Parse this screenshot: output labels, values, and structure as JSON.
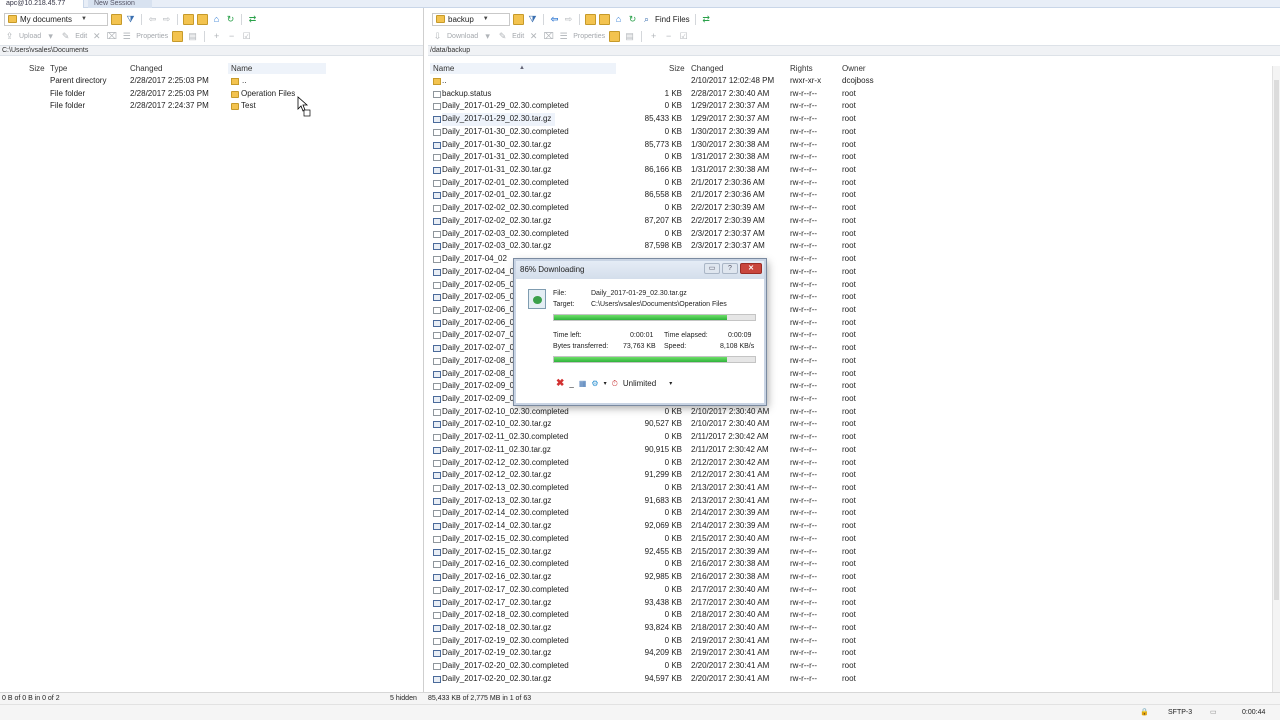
{
  "tabs": {
    "active": "apc@10.218.45.77",
    "new_session": "New Session"
  },
  "left": {
    "drive": "My documents",
    "toolbar2": [
      "Upload",
      "Edit",
      "Properties"
    ],
    "path": "C:\\Users\\vsales\\Documents",
    "columns": {
      "name": "Name",
      "size": "Size",
      "type": "Type",
      "changed": "Changed"
    },
    "rows": [
      {
        "name": "..",
        "type": "Parent directory",
        "changed": "2/28/2017  2:25:03 PM",
        "icon": "up"
      },
      {
        "name": "Operation Files",
        "type": "File folder",
        "changed": "2/28/2017  2:25:03 PM",
        "icon": "folder"
      },
      {
        "name": "Test",
        "type": "File folder",
        "changed": "2/28/2017  2:24:37 PM",
        "icon": "folder"
      }
    ],
    "status": "0 B of 0 B in 0 of 2"
  },
  "right": {
    "folder": "backup",
    "find_files": "Find Files",
    "toolbar2": [
      "Download",
      "Edit",
      "Properties"
    ],
    "path": "/data/backup",
    "columns": {
      "name": "Name",
      "size": "Size",
      "changed": "Changed",
      "rights": "Rights",
      "owner": "Owner"
    },
    "rows": [
      {
        "name": "..",
        "size": "",
        "changed": "2/10/2017 12:02:48 PM",
        "rights": "rwxr-xr-x",
        "owner": "dcojboss",
        "icon": "up"
      },
      {
        "name": "backup.status",
        "size": "1 KB",
        "changed": "2/28/2017 2:30:40 AM",
        "rights": "rw-r--r--",
        "owner": "root",
        "icon": "doc"
      },
      {
        "name": "Daily_2017-01-29_02.30.completed",
        "size": "0 KB",
        "changed": "1/29/2017 2:30:37 AM",
        "rights": "rw-r--r--",
        "owner": "root",
        "icon": "doc"
      },
      {
        "name": "Daily_2017-01-29_02.30.tar.gz",
        "size": "85,433 KB",
        "changed": "1/29/2017 2:30:37 AM",
        "rights": "rw-r--r--",
        "owner": "root",
        "icon": "gz",
        "hl": true
      },
      {
        "name": "Daily_2017-01-30_02.30.completed",
        "size": "0 KB",
        "changed": "1/30/2017 2:30:39 AM",
        "rights": "rw-r--r--",
        "owner": "root",
        "icon": "doc"
      },
      {
        "name": "Daily_2017-01-30_02.30.tar.gz",
        "size": "85,773 KB",
        "changed": "1/30/2017 2:30:38 AM",
        "rights": "rw-r--r--",
        "owner": "root",
        "icon": "gz"
      },
      {
        "name": "Daily_2017-01-31_02.30.completed",
        "size": "0 KB",
        "changed": "1/31/2017 2:30:38 AM",
        "rights": "rw-r--r--",
        "owner": "root",
        "icon": "doc"
      },
      {
        "name": "Daily_2017-01-31_02.30.tar.gz",
        "size": "86,166 KB",
        "changed": "1/31/2017 2:30:38 AM",
        "rights": "rw-r--r--",
        "owner": "root",
        "icon": "gz"
      },
      {
        "name": "Daily_2017-02-01_02.30.completed",
        "size": "0 KB",
        "changed": "2/1/2017 2:30:36 AM",
        "rights": "rw-r--r--",
        "owner": "root",
        "icon": "doc"
      },
      {
        "name": "Daily_2017-02-01_02.30.tar.gz",
        "size": "86,558 KB",
        "changed": "2/1/2017 2:30:36 AM",
        "rights": "rw-r--r--",
        "owner": "root",
        "icon": "gz"
      },
      {
        "name": "Daily_2017-02-02_02.30.completed",
        "size": "0 KB",
        "changed": "2/2/2017 2:30:39 AM",
        "rights": "rw-r--r--",
        "owner": "root",
        "icon": "doc"
      },
      {
        "name": "Daily_2017-02-02_02.30.tar.gz",
        "size": "87,207 KB",
        "changed": "2/2/2017 2:30:39 AM",
        "rights": "rw-r--r--",
        "owner": "root",
        "icon": "gz"
      },
      {
        "name": "Daily_2017-02-03_02.30.completed",
        "size": "0 KB",
        "changed": "2/3/2017 2:30:37 AM",
        "rights": "rw-r--r--",
        "owner": "root",
        "icon": "doc"
      },
      {
        "name": "Daily_2017-02-03_02.30.tar.gz",
        "size": "87,598 KB",
        "changed": "2/3/2017 2:30:37 AM",
        "rights": "rw-r--r--",
        "owner": "root",
        "icon": "gz"
      },
      {
        "name": "Daily_2017-04_02",
        "size": "",
        "changed": "",
        "rights": "rw-r--r--",
        "owner": "root",
        "icon": "doc"
      },
      {
        "name": "Daily_2017-02-04_02",
        "size": "",
        "changed": "",
        "rights": "rw-r--r--",
        "owner": "root",
        "icon": "gz"
      },
      {
        "name": "Daily_2017-02-05_02",
        "size": "",
        "changed": "",
        "rights": "rw-r--r--",
        "owner": "root",
        "icon": "doc"
      },
      {
        "name": "Daily_2017-02-05_02",
        "size": "",
        "changed": "",
        "rights": "rw-r--r--",
        "owner": "root",
        "icon": "gz"
      },
      {
        "name": "Daily_2017-02-06_02",
        "size": "",
        "changed": "",
        "rights": "rw-r--r--",
        "owner": "root",
        "icon": "doc"
      },
      {
        "name": "Daily_2017-02-06_02",
        "size": "",
        "changed": "",
        "rights": "rw-r--r--",
        "owner": "root",
        "icon": "gz"
      },
      {
        "name": "Daily_2017-02-07_02",
        "size": "",
        "changed": "",
        "rights": "rw-r--r--",
        "owner": "root",
        "icon": "doc"
      },
      {
        "name": "Daily_2017-02-07_02",
        "size": "",
        "changed": "",
        "rights": "rw-r--r--",
        "owner": "root",
        "icon": "gz"
      },
      {
        "name": "Daily_2017-02-08_02",
        "size": "",
        "changed": "",
        "rights": "rw-r--r--",
        "owner": "root",
        "icon": "doc"
      },
      {
        "name": "Daily_2017-02-08_02",
        "size": "",
        "changed": "",
        "rights": "rw-r--r--",
        "owner": "root",
        "icon": "gz"
      },
      {
        "name": "Daily_2017-02-09_02",
        "size": "",
        "changed": "",
        "rights": "rw-r--r--",
        "owner": "root",
        "icon": "doc"
      },
      {
        "name": "Daily_2017-02-09_02",
        "size": "",
        "changed": "",
        "rights": "rw-r--r--",
        "owner": "root",
        "icon": "gz"
      },
      {
        "name": "Daily_2017-02-10_02.30.completed",
        "size": "0 KB",
        "changed": "2/10/2017 2:30:40 AM",
        "rights": "rw-r--r--",
        "owner": "root",
        "icon": "doc"
      },
      {
        "name": "Daily_2017-02-10_02.30.tar.gz",
        "size": "90,527 KB",
        "changed": "2/10/2017 2:30:40 AM",
        "rights": "rw-r--r--",
        "owner": "root",
        "icon": "gz"
      },
      {
        "name": "Daily_2017-02-11_02.30.completed",
        "size": "0 KB",
        "changed": "2/11/2017 2:30:42 AM",
        "rights": "rw-r--r--",
        "owner": "root",
        "icon": "doc"
      },
      {
        "name": "Daily_2017-02-11_02.30.tar.gz",
        "size": "90,915 KB",
        "changed": "2/11/2017 2:30:42 AM",
        "rights": "rw-r--r--",
        "owner": "root",
        "icon": "gz"
      },
      {
        "name": "Daily_2017-02-12_02.30.completed",
        "size": "0 KB",
        "changed": "2/12/2017 2:30:42 AM",
        "rights": "rw-r--r--",
        "owner": "root",
        "icon": "doc"
      },
      {
        "name": "Daily_2017-02-12_02.30.tar.gz",
        "size": "91,299 KB",
        "changed": "2/12/2017 2:30:41 AM",
        "rights": "rw-r--r--",
        "owner": "root",
        "icon": "gz"
      },
      {
        "name": "Daily_2017-02-13_02.30.completed",
        "size": "0 KB",
        "changed": "2/13/2017 2:30:41 AM",
        "rights": "rw-r--r--",
        "owner": "root",
        "icon": "doc"
      },
      {
        "name": "Daily_2017-02-13_02.30.tar.gz",
        "size": "91,683 KB",
        "changed": "2/13/2017 2:30:41 AM",
        "rights": "rw-r--r--",
        "owner": "root",
        "icon": "gz"
      },
      {
        "name": "Daily_2017-02-14_02.30.completed",
        "size": "0 KB",
        "changed": "2/14/2017 2:30:39 AM",
        "rights": "rw-r--r--",
        "owner": "root",
        "icon": "doc"
      },
      {
        "name": "Daily_2017-02-14_02.30.tar.gz",
        "size": "92,069 KB",
        "changed": "2/14/2017 2:30:39 AM",
        "rights": "rw-r--r--",
        "owner": "root",
        "icon": "gz"
      },
      {
        "name": "Daily_2017-02-15_02.30.completed",
        "size": "0 KB",
        "changed": "2/15/2017 2:30:40 AM",
        "rights": "rw-r--r--",
        "owner": "root",
        "icon": "doc"
      },
      {
        "name": "Daily_2017-02-15_02.30.tar.gz",
        "size": "92,455 KB",
        "changed": "2/15/2017 2:30:39 AM",
        "rights": "rw-r--r--",
        "owner": "root",
        "icon": "gz"
      },
      {
        "name": "Daily_2017-02-16_02.30.completed",
        "size": "0 KB",
        "changed": "2/16/2017 2:30:38 AM",
        "rights": "rw-r--r--",
        "owner": "root",
        "icon": "doc"
      },
      {
        "name": "Daily_2017-02-16_02.30.tar.gz",
        "size": "92,985 KB",
        "changed": "2/16/2017 2:30:38 AM",
        "rights": "rw-r--r--",
        "owner": "root",
        "icon": "gz"
      },
      {
        "name": "Daily_2017-02-17_02.30.completed",
        "size": "0 KB",
        "changed": "2/17/2017 2:30:40 AM",
        "rights": "rw-r--r--",
        "owner": "root",
        "icon": "doc"
      },
      {
        "name": "Daily_2017-02-17_02.30.tar.gz",
        "size": "93,438 KB",
        "changed": "2/17/2017 2:30:40 AM",
        "rights": "rw-r--r--",
        "owner": "root",
        "icon": "gz"
      },
      {
        "name": "Daily_2017-02-18_02.30.completed",
        "size": "0 KB",
        "changed": "2/18/2017 2:30:40 AM",
        "rights": "rw-r--r--",
        "owner": "root",
        "icon": "doc"
      },
      {
        "name": "Daily_2017-02-18_02.30.tar.gz",
        "size": "93,824 KB",
        "changed": "2/18/2017 2:30:40 AM",
        "rights": "rw-r--r--",
        "owner": "root",
        "icon": "gz"
      },
      {
        "name": "Daily_2017-02-19_02.30.completed",
        "size": "0 KB",
        "changed": "2/19/2017 2:30:41 AM",
        "rights": "rw-r--r--",
        "owner": "root",
        "icon": "doc"
      },
      {
        "name": "Daily_2017-02-19_02.30.tar.gz",
        "size": "94,209 KB",
        "changed": "2/19/2017 2:30:41 AM",
        "rights": "rw-r--r--",
        "owner": "root",
        "icon": "gz"
      },
      {
        "name": "Daily_2017-02-20_02.30.completed",
        "size": "0 KB",
        "changed": "2/20/2017 2:30:41 AM",
        "rights": "rw-r--r--",
        "owner": "root",
        "icon": "doc"
      },
      {
        "name": "Daily_2017-02-20_02.30.tar.gz",
        "size": "94,597 KB",
        "changed": "2/20/2017 2:30:41 AM",
        "rights": "rw-r--r--",
        "owner": "root",
        "icon": "gz"
      }
    ],
    "hidden": "5 hidden",
    "status": "85,433 KB of 2,775 MB in 1 of 63"
  },
  "dialog": {
    "title": "86% Downloading",
    "file_label": "File:",
    "file": "Daily_2017-01-29_02.30.tar.gz",
    "target_label": "Target:",
    "target": "C:\\Users\\vsales\\Documents\\Operation Files",
    "time_left_label": "Time left:",
    "time_left": "0:00:01",
    "time_elapsed_label": "Time elapsed:",
    "time_elapsed": "0:00:09",
    "bytes_label": "Bytes transferred:",
    "bytes": "73,763 KB",
    "speed_label": "Speed:",
    "speed": "8,108 KB/s",
    "file_progress": 0.86,
    "total_progress": 0.86,
    "speed_limit": "Unlimited"
  },
  "bottom": {
    "protocol": "SFTP-3",
    "elapsed": "0:00:44"
  },
  "colors": {
    "progress": "#2fb33b",
    "folder": "#f3c34f",
    "cancel": "#d23030"
  }
}
